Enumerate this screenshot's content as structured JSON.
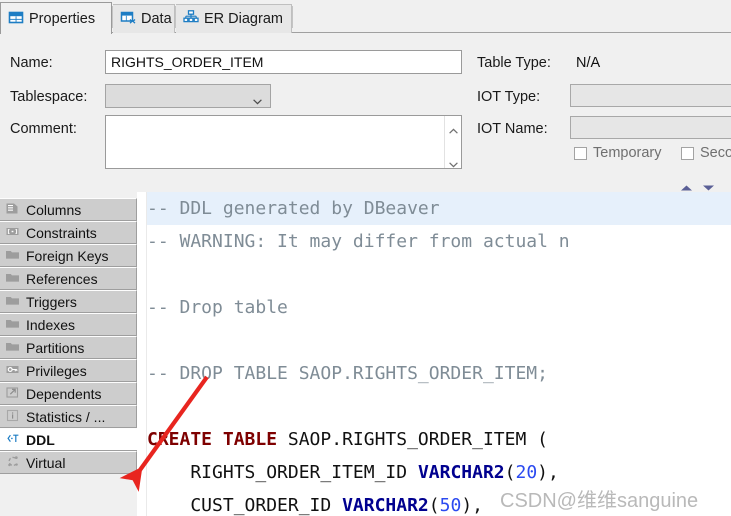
{
  "tabs": [
    {
      "label": "Properties",
      "icon": "table-properties-icon",
      "selected": true
    },
    {
      "label": "Data",
      "icon": "data-grid-icon",
      "selected": false
    },
    {
      "label": "ER Diagram",
      "icon": "er-diagram-icon",
      "selected": false
    }
  ],
  "form": {
    "name_label": "Name:",
    "name_value": "RIGHTS_ORDER_ITEM",
    "tablespace_label": "Tablespace:",
    "tablespace_value": "",
    "comment_label": "Comment:",
    "comment_value": "",
    "table_type_label": "Table Type:",
    "table_type_value": "N/A",
    "iot_type_label": "IOT Type:",
    "iot_type_value": "",
    "iot_name_label": "IOT Name:",
    "iot_name_value": "",
    "temporary_label": "Temporary",
    "secondary_label": "Secondary"
  },
  "sidebar": {
    "items": [
      {
        "label": "Columns",
        "icon": "columns-icon",
        "selected": false
      },
      {
        "label": "Constraints",
        "icon": "constraints-icon",
        "selected": false
      },
      {
        "label": "Foreign Keys",
        "icon": "folder-icon",
        "selected": false
      },
      {
        "label": "References",
        "icon": "folder-icon",
        "selected": false
      },
      {
        "label": "Triggers",
        "icon": "folder-icon",
        "selected": false
      },
      {
        "label": "Indexes",
        "icon": "folder-icon",
        "selected": false
      },
      {
        "label": "Partitions",
        "icon": "folder-icon",
        "selected": false
      },
      {
        "label": "Privileges",
        "icon": "key-icon",
        "selected": false
      },
      {
        "label": "Dependents",
        "icon": "external-link-icon",
        "selected": false
      },
      {
        "label": "Statistics / ...",
        "icon": "info-icon",
        "selected": false
      },
      {
        "label": "DDL",
        "icon": "ddl-text-icon",
        "selected": true
      },
      {
        "label": "Virtual",
        "icon": "virtual-icon",
        "selected": false
      }
    ]
  },
  "editor": {
    "lines": [
      {
        "current": true,
        "tokens": [
          {
            "t": "-- DDL generated by DBeaver",
            "c": "cm"
          }
        ]
      },
      {
        "current": false,
        "tokens": [
          {
            "t": "-- WARNING: It may differ from actual n",
            "c": "cm"
          }
        ]
      },
      {
        "current": false,
        "tokens": [
          {
            "t": "",
            "c": "cm"
          }
        ]
      },
      {
        "current": false,
        "tokens": [
          {
            "t": "-- Drop table",
            "c": "cm"
          }
        ]
      },
      {
        "current": false,
        "tokens": [
          {
            "t": "",
            "c": "cm"
          }
        ]
      },
      {
        "current": false,
        "tokens": [
          {
            "t": "-- DROP TABLE SAOP.RIGHTS_ORDER_ITEM;",
            "c": "cm"
          }
        ]
      },
      {
        "current": false,
        "tokens": [
          {
            "t": "",
            "c": "cm"
          }
        ]
      },
      {
        "current": false,
        "tokens": [
          {
            "t": "CREATE TABLE",
            "c": "kw"
          },
          {
            "t": " SAOP.RIGHTS_ORDER_ITEM (",
            "c": "pl"
          }
        ]
      },
      {
        "current": false,
        "tokens": [
          {
            "t": "    RIGHTS_ORDER_ITEM_ID ",
            "c": "pl"
          },
          {
            "t": "VARCHAR2",
            "c": "ty"
          },
          {
            "t": "(",
            "c": "pl"
          },
          {
            "t": "20",
            "c": "num"
          },
          {
            "t": "),",
            "c": "pl"
          }
        ]
      },
      {
        "current": false,
        "tokens": [
          {
            "t": "    CUST_ORDER_ID ",
            "c": "pl"
          },
          {
            "t": "VARCHAR2",
            "c": "ty"
          },
          {
            "t": "(",
            "c": "pl"
          },
          {
            "t": "50",
            "c": "num"
          },
          {
            "t": "),",
            "c": "pl"
          }
        ]
      }
    ],
    "collapse_up_icon": "collapse-up-icon",
    "collapse_down_icon": "collapse-down-icon"
  },
  "annotation": {
    "arrow_color": "#e8251f",
    "arrow_name": "red-pointer-arrow"
  },
  "watermark": {
    "text": "CSDN@维维sanguine"
  },
  "colors": {
    "accent": "#1d7dc4",
    "comment": "#7f8c96",
    "keyword": "#7e0000",
    "type": "#00008f",
    "number": "#2b4af0",
    "current_line": "#e6f0fb",
    "chrome": "#f0f0f0",
    "tab_bg": "#cdcdcd"
  }
}
